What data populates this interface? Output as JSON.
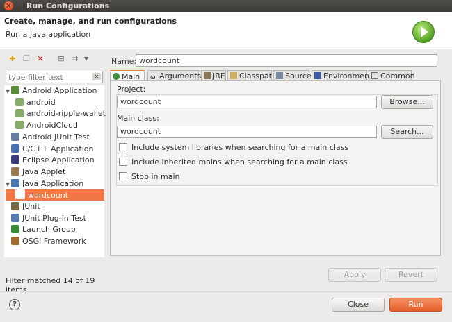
{
  "window": {
    "title": "Run Configurations"
  },
  "header": {
    "title": "Create, manage, and run configurations",
    "subtitle": "Run a Java application"
  },
  "filter": {
    "placeholder": "type filter text"
  },
  "tree": [
    {
      "label": "Android Application",
      "level": 0,
      "expanded": true,
      "icon": "android-app-icon",
      "color": "#5a8a3a"
    },
    {
      "label": "android",
      "level": 1,
      "icon": "android-config-icon",
      "color": "#8aaa6a"
    },
    {
      "label": "android-ripple-wallet",
      "level": 1,
      "icon": "android-config-icon",
      "color": "#8aaa6a"
    },
    {
      "label": "AndroidCloud",
      "level": 1,
      "icon": "android-config-icon",
      "color": "#8aaa6a"
    },
    {
      "label": "Android JUnit Test",
      "level": 0,
      "icon": "junit-icon",
      "color": "#6a7fa0"
    },
    {
      "label": "C/C++ Application",
      "level": 0,
      "icon": "cpp-icon",
      "color": "#4a6fb0"
    },
    {
      "label": "Eclipse Application",
      "level": 0,
      "icon": "eclipse-icon",
      "color": "#3b3b7a"
    },
    {
      "label": "Java Applet",
      "level": 0,
      "icon": "applet-icon",
      "color": "#9a7a50"
    },
    {
      "label": "Java Application",
      "level": 0,
      "expanded": true,
      "icon": "java-app-icon",
      "color": "#4a7ab0"
    },
    {
      "label": "wordcount",
      "level": 1,
      "selected": true,
      "icon": "java-config-icon",
      "color": "#ffffff"
    },
    {
      "label": "JUnit",
      "level": 0,
      "icon": "junit-icon",
      "color": "#7a6a40"
    },
    {
      "label": "JUnit Plug-in Test",
      "level": 0,
      "icon": "junit-plugin-icon",
      "color": "#5a7ab0"
    },
    {
      "label": "Launch Group",
      "level": 0,
      "icon": "launch-group-icon",
      "color": "#3a8a3a"
    },
    {
      "label": "OSGi Framework",
      "level": 0,
      "icon": "osgi-icon",
      "color": "#a06a30"
    }
  ],
  "status": "Filter matched 14 of 19 items",
  "name": {
    "label": "Name:",
    "value": "wordcount"
  },
  "tabs": [
    "Main",
    "Arguments",
    "JRE",
    "Classpath",
    "Source",
    "Environment",
    "Common"
  ],
  "main": {
    "project_label": "Project:",
    "project_value": "wordcount",
    "browse": "Browse...",
    "mainclass_label": "Main class:",
    "mainclass_value": "wordcount",
    "search": "Search...",
    "checks": [
      "Include system libraries when searching for a main class",
      "Include inherited mains when searching for a main class",
      "Stop in main"
    ]
  },
  "buttons": {
    "apply": "Apply",
    "revert": "Revert",
    "close": "Close",
    "run": "Run"
  },
  "help": "?",
  "colors": {
    "accent": "#e47c42",
    "run_button": "#e6602b",
    "selection": "#f07746"
  }
}
